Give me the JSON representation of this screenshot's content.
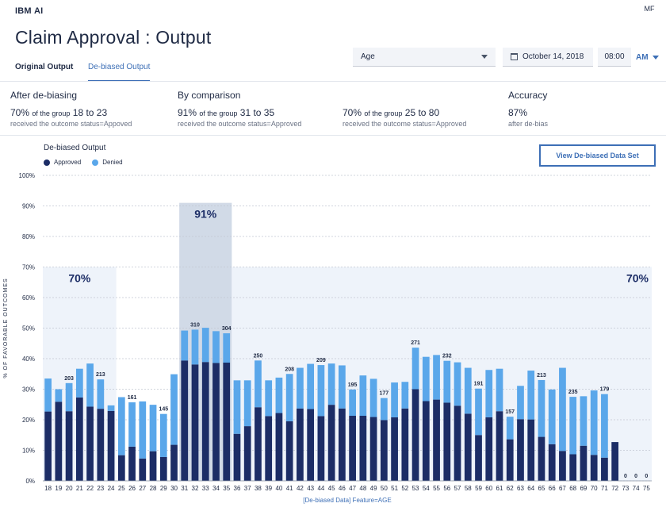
{
  "header": {
    "brand_prefix": "IBM",
    "brand_suffix": "AI",
    "user_initials": "MF"
  },
  "page": {
    "title": "Claim Approval : Output"
  },
  "tabs": [
    {
      "label": "Original Output"
    },
    {
      "label": "De-biased Output"
    }
  ],
  "filters": {
    "feature_select": "Age",
    "date": "October 14, 2018",
    "time": "08:00",
    "ampm": "AM"
  },
  "stats": [
    {
      "heading": "After de-biasing",
      "pct": "70%",
      "mid": "of the group",
      "range": "18 to 23",
      "sub": "received the outcome status=Appoved"
    },
    {
      "heading": "By comparison",
      "pct": "91%",
      "mid": "of the group",
      "range": "31 to 35",
      "sub": "received the outcome status=Approved"
    },
    {
      "heading": "",
      "pct": "70%",
      "mid": "of the group",
      "range": "25 to 80",
      "sub": "received the outcome status=Approved"
    },
    {
      "heading": "Accuracy",
      "pct": "87%",
      "mid": "",
      "range": "",
      "sub": "after de-bias"
    }
  ],
  "chart_header": {
    "title": "De-biased Output",
    "view_button": "View De-biased Data Set"
  },
  "colors": {
    "approved": "#1c2d66",
    "denied": "#5aa7ea",
    "band": "#eef3fa",
    "band_dark": "#c9d4e3",
    "accent": "#3d6fb6"
  },
  "chart_data": {
    "type": "bar",
    "stacked": true,
    "xlabel": "[De-biased Data] Feature=AGE",
    "ylabel": "% OF FAVORABLE OUTCOMES",
    "ylim": [
      0,
      100
    ],
    "yticks": [
      "0%",
      "10%",
      "20%",
      "30%",
      "40%",
      "50%",
      "60%",
      "70%",
      "80%",
      "90%",
      "100%"
    ],
    "legend": [
      "Approved",
      "Denied"
    ],
    "categories": [
      "18",
      "19",
      "20",
      "21",
      "22",
      "23",
      "24",
      "25",
      "26",
      "27",
      "28",
      "29",
      "30",
      "31",
      "32",
      "33",
      "34",
      "35",
      "36",
      "37",
      "38",
      "39",
      "40",
      "41",
      "42",
      "43",
      "44",
      "45",
      "46",
      "47",
      "48",
      "49",
      "50",
      "51",
      "52",
      "53",
      "54",
      "55",
      "56",
      "57",
      "58",
      "59",
      "60",
      "61",
      "62",
      "63",
      "64",
      "65",
      "66",
      "67",
      "68",
      "69",
      "70",
      "71",
      "72",
      "73",
      "74",
      "75"
    ],
    "series": [
      {
        "name": "Approved",
        "values": [
          22.7,
          25.9,
          22.8,
          27.3,
          24.3,
          23.6,
          22.9,
          8.4,
          11.2,
          7.3,
          9.7,
          7.8,
          11.8,
          39.4,
          38.1,
          38.9,
          38.6,
          38.7,
          15.4,
          17.9,
          24.1,
          21.2,
          22.2,
          19.5,
          23.7,
          23.5,
          21.2,
          24.9,
          23.7,
          21.3,
          21.3,
          20.9,
          19.9,
          20.8,
          23.7,
          30.0,
          26.1,
          26.6,
          25.6,
          24.6,
          22.0,
          15.0,
          20.8,
          22.8,
          13.6,
          20.2,
          20.1,
          14.4,
          12.0,
          9.8,
          8.7,
          11.5,
          8.5,
          7.6,
          12.7,
          0,
          0,
          0
        ]
      },
      {
        "name": "Denied",
        "values": [
          10.8,
          4.1,
          9.2,
          9.4,
          14.1,
          9.6,
          1.8,
          19.0,
          14.5,
          18.7,
          15.2,
          14.1,
          23.1,
          9.8,
          11.4,
          11.2,
          10.4,
          9.6,
          17.5,
          15.0,
          15.3,
          11.7,
          11.6,
          15.5,
          13.3,
          14.8,
          16.7,
          13.5,
          14.1,
          8.6,
          13.2,
          12.5,
          7.2,
          11.4,
          8.7,
          13.6,
          14.5,
          14.6,
          13.7,
          14.2,
          15.0,
          15.2,
          15.5,
          13.9,
          7.4,
          10.9,
          16.0,
          18.6,
          17.9,
          27.2,
          18.8,
          16.2,
          21.1,
          20.8,
          0,
          0,
          0,
          0
        ]
      }
    ],
    "totals": [
      {
        "category": "20",
        "label": "203"
      },
      {
        "category": "23",
        "label": "213"
      },
      {
        "category": "26",
        "label": "161"
      },
      {
        "category": "29",
        "label": "145"
      },
      {
        "category": "32",
        "label": "310"
      },
      {
        "category": "35",
        "label": "304"
      },
      {
        "category": "38",
        "label": "250"
      },
      {
        "category": "41",
        "label": "208"
      },
      {
        "category": "44",
        "label": "209"
      },
      {
        "category": "47",
        "label": "195"
      },
      {
        "category": "50",
        "label": "177"
      },
      {
        "category": "53",
        "label": "271"
      },
      {
        "category": "56",
        "label": "232"
      },
      {
        "category": "59",
        "label": "191"
      },
      {
        "category": "62",
        "label": "157"
      },
      {
        "category": "65",
        "label": "213"
      },
      {
        "category": "68",
        "label": "235"
      },
      {
        "category": "71",
        "label": "179"
      },
      {
        "category": "73",
        "label": "0"
      },
      {
        "category": "74",
        "label": "0"
      },
      {
        "category": "75",
        "label": "0"
      }
    ],
    "bands": [
      {
        "from": "18",
        "to": "24",
        "value": 70,
        "label": "70%"
      },
      {
        "from": "31",
        "to": "35",
        "value": 91,
        "label": "91%"
      },
      {
        "from": "36",
        "to": "75",
        "value": 70,
        "label": "70%"
      }
    ]
  }
}
